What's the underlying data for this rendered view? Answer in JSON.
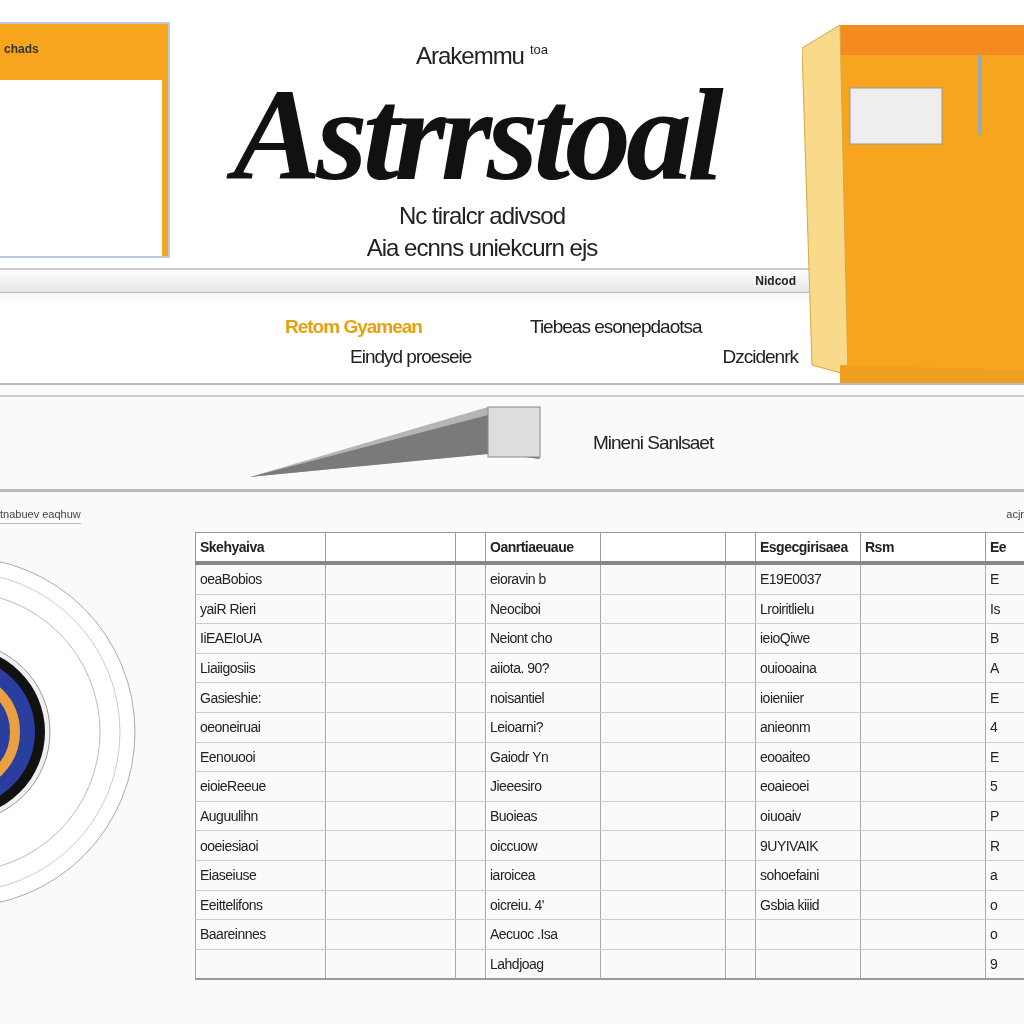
{
  "side_panel": {
    "title": "chads"
  },
  "header": {
    "kicker": "Arakemmu",
    "kicker_note": "toa",
    "title": "Astrrstoal",
    "subtitle_lines": [
      "Nc tiralcr adivsod",
      "Aia ecnns uniekcurn ejs"
    ]
  },
  "strip": {
    "label": "Nidcod"
  },
  "summary": {
    "link": "Retom Gyamean",
    "line_1_right": "Tiebeas esonepdaotsa",
    "line_2_left": "Eindyd proeseie",
    "line_2_right": "Dzcidenrk"
  },
  "feature": {
    "caption": "Mineni Sanlsaet"
  },
  "section": {
    "left_label": "tnabuev eaqhuw",
    "right_label": "acjr"
  },
  "table": {
    "columns": [
      {
        "label": "Skehyaiva"
      },
      {},
      {},
      {
        "label": "Oanrtiaeuaue"
      },
      {},
      {},
      {
        "label": "Esgecgirisaea"
      },
      {
        "label": "Rsm"
      },
      {
        "label": "Ee"
      }
    ],
    "rows": [
      {
        "column_1": "oeaBobios",
        "column_4": "eioravin b",
        "column_7": "E19E0037",
        "column_9": "E"
      },
      {
        "column_1": "yaiR Rieri",
        "column_4": "Neociboi",
        "column_7": "Lroiritlielu",
        "column_9": "Is"
      },
      {
        "column_1": "IiEAEIoUA",
        "column_4": "Neiont cho",
        "column_7": "ieioQiwe",
        "column_9": "B"
      },
      {
        "column_1": "Liaiigosiis",
        "column_4": "aiiota. 90?",
        "column_7": "ouiooaina",
        "column_9": "A"
      },
      {
        "column_1": "Gasieshie:",
        "column_4": "noisantiel",
        "column_7": "ioieniier",
        "column_9": "E"
      },
      {
        "column_1": "oeoneiruai",
        "column_4": "Leioarni?",
        "column_7": "anieonm",
        "column_9": "4"
      },
      {
        "column_1": "Eenouooi",
        "column_4": "Gaiodr Yn",
        "column_7": "eooaiteo",
        "column_9": "E"
      },
      {
        "column_1": "eioieReeue",
        "column_4": "Jieeesiro",
        "column_7": "eoaieoei",
        "column_9": "5"
      },
      {
        "column_1": "Auguulihn",
        "column_4": "Buoieas",
        "column_7": "oiuoaiv",
        "column_9": "P"
      },
      {
        "column_1": "ooeiesiaoi",
        "column_4": "oiccuow",
        "column_7": "9UYIVAIK",
        "column_9": "R"
      },
      {
        "column_1": "Eiaseiuse",
        "column_4": "iaroicea",
        "column_7": "sohoefaini",
        "column_9": "a"
      },
      {
        "column_1": "Eeittelifons",
        "column_4": "oicreiu. 4'",
        "column_7": "Gsbia kiiid",
        "column_9": "o"
      },
      {
        "column_1": "Baareinnes",
        "column_4": "Aecuoc .Isa",
        "column_9": "o"
      },
      {
        "column_4": "Lahdjoag",
        "column_9": "9"
      }
    ]
  }
}
